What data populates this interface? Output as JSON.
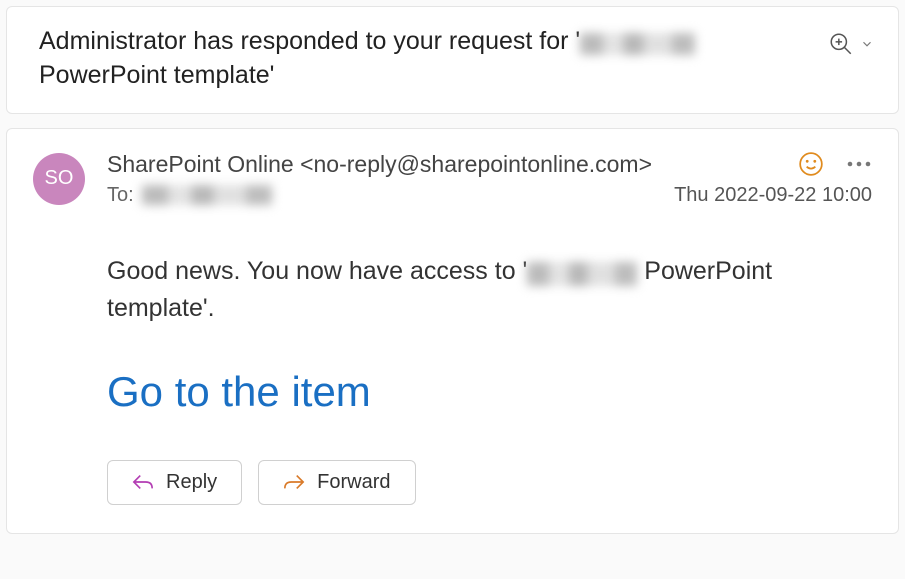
{
  "subject": {
    "pre": "Administrator has responded to your request for '",
    "post": " PowerPoint template'"
  },
  "sender": {
    "initials": "SO",
    "display": "SharePoint Online <no-reply@sharepointonline.com>"
  },
  "to_label": "To:",
  "timestamp": "Thu 2022-09-22 10:00",
  "body": {
    "pre": "Good news. You now have access to '",
    "post": " PowerPoint template'."
  },
  "link_label": "Go to the item",
  "actions": {
    "reply": "Reply",
    "forward": "Forward"
  }
}
